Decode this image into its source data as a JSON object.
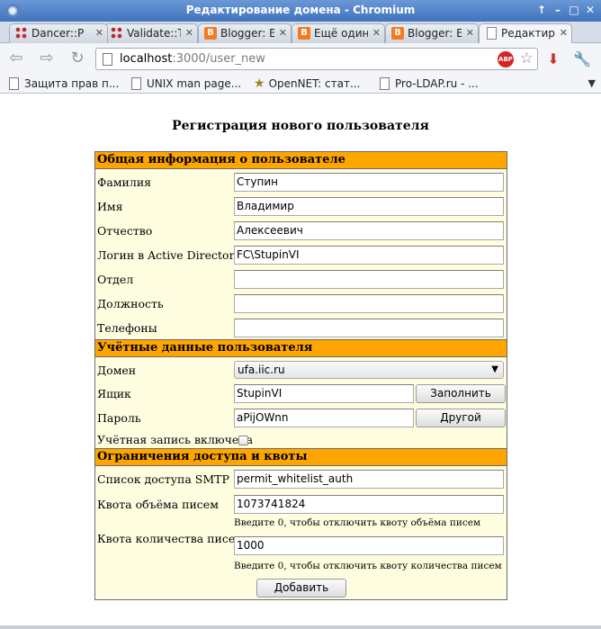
{
  "window": {
    "title": "Редактирование домена - Chromium",
    "controls": [
      "↑",
      "–",
      "□",
      "✕"
    ]
  },
  "tabs": [
    {
      "label": "Dancer::P",
      "icon": "dancer-icon"
    },
    {
      "label": "Validate::T",
      "icon": "dancer-icon"
    },
    {
      "label": "Blogger: E",
      "icon": "blogger-icon"
    },
    {
      "label": "Ещё один",
      "icon": "blogger-icon"
    },
    {
      "label": "Blogger: E",
      "icon": "blogger-icon"
    },
    {
      "label": "Редактир",
      "icon": "page-icon",
      "active": true
    }
  ],
  "address_bar": {
    "host": "localhost",
    "path": ":3000/user_new",
    "adblock_label": "ABP"
  },
  "bookmarks": [
    {
      "label": "Защита прав п...",
      "icon": "page-icon"
    },
    {
      "label": "UNIX man page...",
      "icon": "page-icon"
    },
    {
      "label": "OpenNET: стат...",
      "icon": "star-icon"
    },
    {
      "label": "Pro-LDAP.ru - ...",
      "icon": "page-icon"
    }
  ],
  "form": {
    "title": "Регистрация нового пользователя",
    "sections": {
      "general": "Общая информация о пользователе",
      "account": "Учётные данные пользователя",
      "limits": "Ограничения доступа и квоты"
    },
    "fields": {
      "last_name": {
        "label": "Фамилия",
        "value": "Ступин"
      },
      "first_name": {
        "label": "Имя",
        "value": "Владимир"
      },
      "patronymic": {
        "label": "Отчество",
        "value": "Алексеевич"
      },
      "ad_login": {
        "label": "Логин в Active Directory",
        "value": "FC\\StupinVI"
      },
      "department": {
        "label": "Отдел",
        "value": ""
      },
      "position": {
        "label": "Должность",
        "value": ""
      },
      "phones": {
        "label": "Телефоны",
        "value": ""
      },
      "domain": {
        "label": "Домен",
        "value": "ufa.iic.ru"
      },
      "mailbox": {
        "label": "Ящик",
        "value": "StupinVI"
      },
      "password": {
        "label": "Пароль",
        "value": "aPijOWnn"
      },
      "enabled": {
        "label": "Учётная запись включена",
        "checked": false
      },
      "smtp_acl": {
        "label": "Список доступа SMTP",
        "value": "permit_whitelist_auth"
      },
      "size_quota": {
        "label": "Квота объёма писем",
        "value": "1073741824",
        "hint": "Введите 0, чтобы отключить квоту объёма писем"
      },
      "count_quota": {
        "label": "Квота количества писем",
        "value": "1000",
        "hint": "Введите 0, чтобы отключить квоту количества писем"
      }
    },
    "buttons": {
      "fill": "Заполнить",
      "other": "Другой",
      "submit": "Добавить"
    }
  },
  "colors": {
    "section_header": "#ffa500",
    "form_background": "#fffde0",
    "titlebar": "#4a7cc3"
  }
}
